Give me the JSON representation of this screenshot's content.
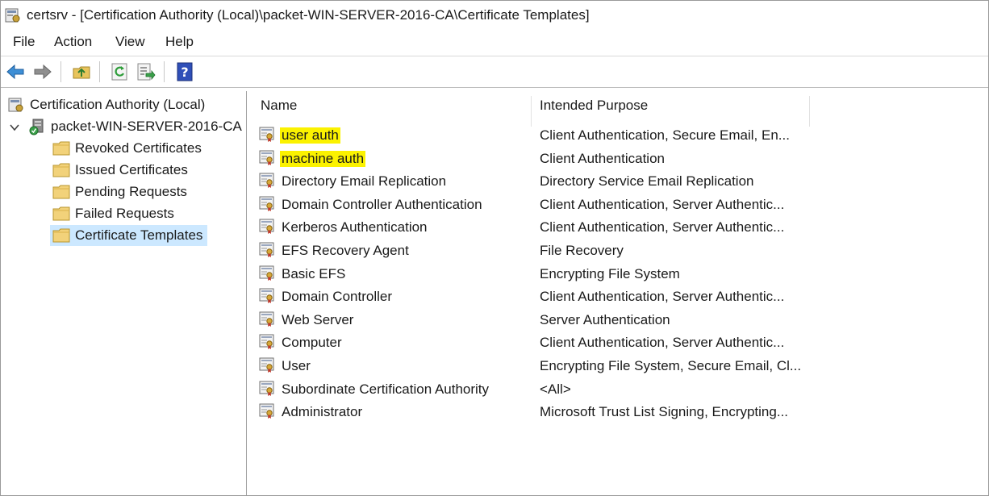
{
  "window": {
    "title": "certsrv - [Certification Authority (Local)\\packet-WIN-SERVER-2016-CA\\Certificate Templates]"
  },
  "menu": [
    "File",
    "Action",
    "View",
    "Help"
  ],
  "toolbar": [
    "back-icon",
    "forward-icon",
    "up-folder-icon",
    "refresh-icon",
    "export-list-icon",
    "help-icon"
  ],
  "tree": {
    "root": "Certification Authority (Local)",
    "ca": "packet-WIN-SERVER-2016-CA",
    "children": [
      "Revoked Certificates",
      "Issued Certificates",
      "Pending Requests",
      "Failed Requests",
      "Certificate Templates"
    ],
    "selected": "Certificate Templates"
  },
  "list": {
    "columns": [
      "Name",
      "Intended Purpose"
    ],
    "rows": [
      {
        "name": "user auth",
        "purpose": "Client Authentication, Secure Email, En...",
        "highlight": true
      },
      {
        "name": "machine auth",
        "purpose": "Client Authentication",
        "highlight": true
      },
      {
        "name": "Directory Email Replication",
        "purpose": "Directory Service Email Replication"
      },
      {
        "name": "Domain Controller Authentication",
        "purpose": "Client Authentication, Server Authentic..."
      },
      {
        "name": "Kerberos Authentication",
        "purpose": "Client Authentication, Server Authentic..."
      },
      {
        "name": "EFS Recovery Agent",
        "purpose": "File Recovery"
      },
      {
        "name": "Basic EFS",
        "purpose": "Encrypting File System"
      },
      {
        "name": "Domain Controller",
        "purpose": "Client Authentication, Server Authentic..."
      },
      {
        "name": "Web Server",
        "purpose": "Server Authentication"
      },
      {
        "name": "Computer",
        "purpose": "Client Authentication, Server Authentic..."
      },
      {
        "name": "User",
        "purpose": "Encrypting File System, Secure Email, Cl..."
      },
      {
        "name": "Subordinate Certification Authority",
        "purpose": "<All>"
      },
      {
        "name": "Administrator",
        "purpose": "Microsoft Trust List Signing, Encrypting..."
      }
    ]
  },
  "colors": {
    "highlight": "#fbf200",
    "selection": "#cce8ff",
    "folder": "#f2d27a"
  }
}
